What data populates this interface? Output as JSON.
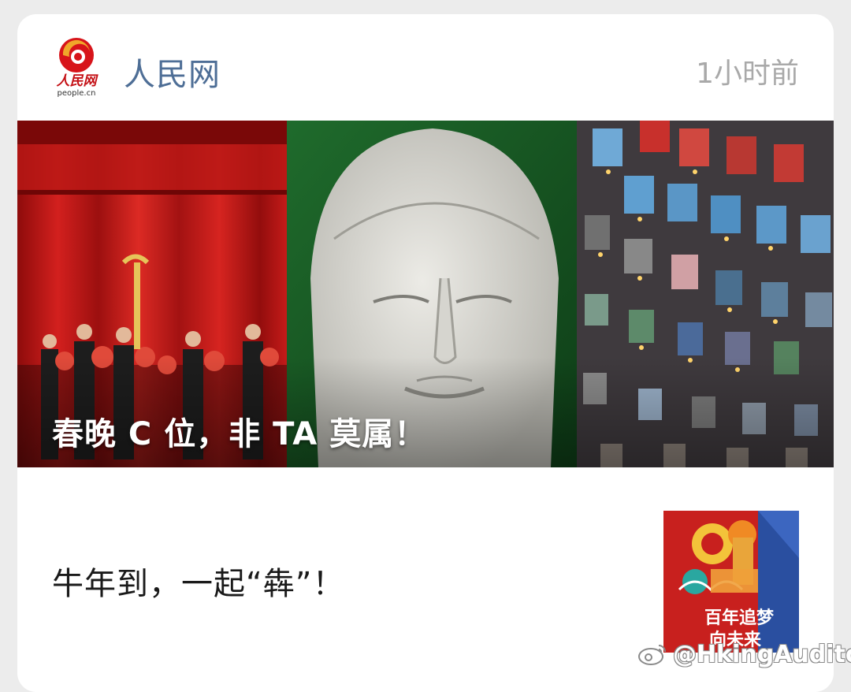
{
  "header": {
    "logo_text": "人民网",
    "logo_subtext": "people.cn",
    "account_name": "人民网",
    "timestamp": "1小时前"
  },
  "hero": {
    "title": "春晚 C 位，非 TA 莫属！"
  },
  "article": {
    "title": "牛年到，一起“犇”！",
    "thumbnail_line1": "百年追梦",
    "thumbnail_line2": "向未来"
  },
  "watermark": {
    "text": "@HkingAuditore"
  },
  "colors": {
    "account_name": "#4e6e96",
    "timestamp": "#a9a9a9",
    "logo_red": "#d7141a",
    "logo_gold": "#f0a72a"
  },
  "icons": {
    "logo": "people-daily-logo-icon",
    "watermark": "weibo-icon"
  }
}
